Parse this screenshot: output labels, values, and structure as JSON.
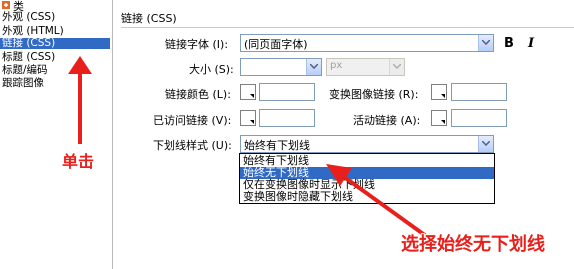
{
  "left_panel": {
    "corner_label": "类",
    "items": [
      {
        "label": "外观 (CSS)",
        "selected": false
      },
      {
        "label": "外观 (HTML)",
        "selected": false
      },
      {
        "label": "链接 (CSS)",
        "selected": true
      },
      {
        "label": "标题 (CSS)",
        "selected": false
      },
      {
        "label": "标题/编码",
        "selected": false
      },
      {
        "label": "跟踪图像",
        "selected": false
      }
    ]
  },
  "main": {
    "section_title": "链接 (CSS)",
    "font": {
      "label": "链接字体 (I):",
      "value": "(同页面字体)"
    },
    "format_buttons": {
      "bold": "B",
      "italic": "I"
    },
    "size": {
      "label": "大小 (S):",
      "value": "",
      "unit": "px"
    },
    "link_color": {
      "label": "链接颜色 (L):"
    },
    "rollover": {
      "label": "变换图像链接 (R):"
    },
    "visited": {
      "label": "已访问链接 (V):"
    },
    "active": {
      "label": "活动链接 (A):"
    },
    "underline": {
      "label": "下划线样式 (U):",
      "value": "始终有下划线",
      "options": [
        "始终有下划线",
        "始终无下划线",
        "仅在变换图像时显示下划线",
        "变换图像时隐藏下划线"
      ],
      "highlighted_index": 1
    }
  },
  "annotations": {
    "click": "单击",
    "select": "选择始终无下划线",
    "color": "#e8201c"
  }
}
